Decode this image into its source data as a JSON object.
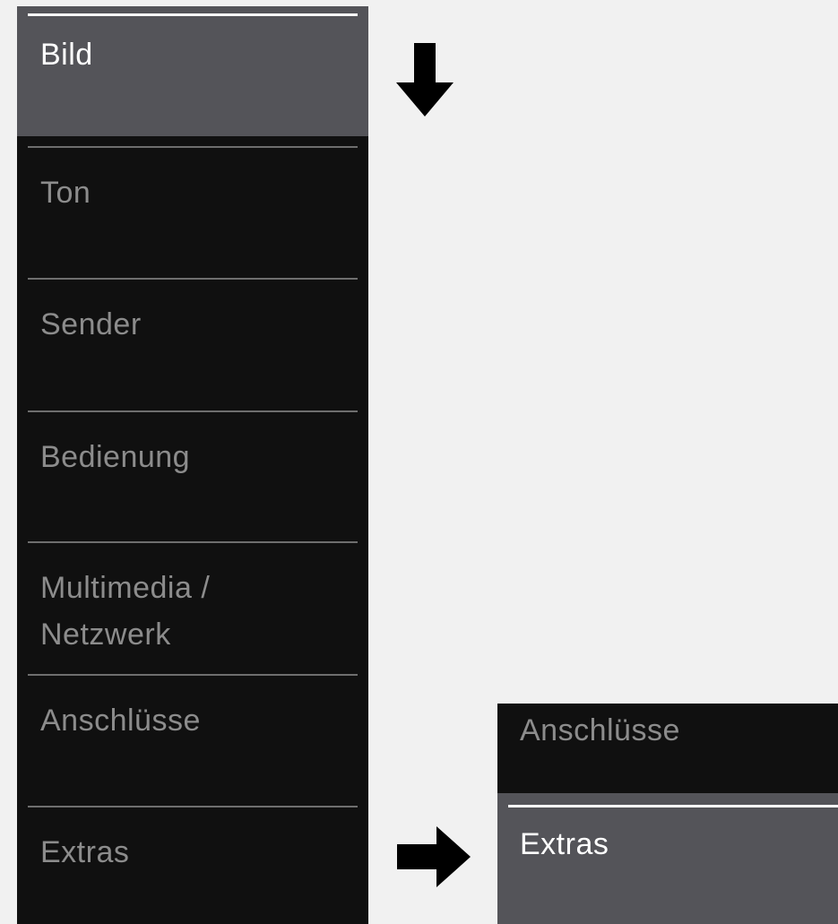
{
  "menu": {
    "items": [
      {
        "label": "Bild",
        "selected": true
      },
      {
        "label": "Ton",
        "selected": false
      },
      {
        "label": "Sender",
        "selected": false
      },
      {
        "label": "Bedienung",
        "selected": false
      },
      {
        "label": "Multimedia /\nNetzwerk",
        "selected": false
      },
      {
        "label": "Anschlüsse",
        "selected": false
      },
      {
        "label": "Extras",
        "selected": false
      }
    ]
  },
  "zoom": {
    "previous_label": "Anschlüsse",
    "selected_label": "Extras"
  },
  "icons": {
    "down_arrow": "arrow-down-icon",
    "right_arrow": "arrow-right-icon"
  },
  "colors": {
    "menu_background": "#101010",
    "selected_background": "#545459",
    "label_inactive": "#8c8c8c",
    "label_active": "#ffffff",
    "page_background": "#f1f1f1"
  }
}
